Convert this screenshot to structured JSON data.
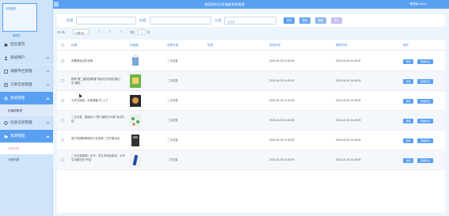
{
  "app": {
    "title": "校园资料分享储备系统管理",
    "user": "管理者 admin"
  },
  "sidebar": {
    "avatar_text": "清风校园",
    "avatar_label": "管理员",
    "items": [
      {
        "label": "后台首页",
        "icon": "home-icon",
        "has_sub": false
      },
      {
        "label": "系统用户",
        "icon": "user-icon",
        "has_sub": true
      },
      {
        "label": "海报专栏管理",
        "icon": "poster-icon",
        "has_sub": true
      },
      {
        "label": "订单信息管理",
        "icon": "order-icon",
        "has_sub": true
      },
      {
        "label": "系统管理",
        "icon": "gear-icon",
        "has_sub": true,
        "active": true
      },
      {
        "label": "社会信息管理",
        "icon": "info-icon",
        "has_sub": true
      },
      {
        "label": "资源管理",
        "icon": "folder-icon",
        "has_sub": true,
        "active": true
      }
    ],
    "sub_items": {
      "system": [
        "轮播图管理"
      ],
      "resource": [
        "资源列表",
        "分类列表"
      ]
    }
  },
  "search": {
    "label_1": "标题",
    "label_2": "标题",
    "label_3": "分类",
    "placeholder_3": "请选择",
    "btn_search": "查询",
    "btn_add": "新增",
    "btn_delete": "删除",
    "btn_export": "导出"
  },
  "pager": {
    "total_label": "共 6 条",
    "page_size": "10条/页",
    "prev": "<",
    "page": "1",
    "next": ">",
    "goto_label": "前往",
    "goto_value": "1",
    "page_unit": "页"
  },
  "table": {
    "headers": [
      "标题",
      "封面图",
      "资源分类",
      "标签",
      "发布时间",
      "更新时间",
      "操作"
    ],
    "rows": [
      {
        "title": "闲置物品出售说明",
        "category": "二手交易",
        "published": "2024-04-03 14:45:05",
        "updated": "2024-04-03 14:45:31",
        "thumb": "#7aa6d8"
      },
      {
        "title": "框架\"第二届校园新春书画文化作品征集公告\"通知",
        "category": "二手交易",
        "published": "2024-04-03 14:45:05",
        "updated": "2024-04-03 14:45:05",
        "thumb": "#6fb54a"
      },
      {
        "title": "大学生宿舍，你被哪套\"忘\"上了",
        "category": "二手交易",
        "published": "2024-04-03 14:45:05",
        "updated": "2024-04-03 14:45:05",
        "thumb": "#2a2a2a"
      },
      {
        "title": "二手交易，超级名人\"第十届知识大赛\"活动总结",
        "category": "二手交易",
        "published": "2024-04-03 14:45:05",
        "updated": "2024-04-03 14:45:05",
        "thumb": "#4ca86b"
      },
      {
        "title": "基于校园助教服务平台的第二次开展活动",
        "category": "二手交易",
        "published": "2024-04-03 14:45:05",
        "updated": "2024-04-03 14:45:05",
        "thumb": "#333333"
      },
      {
        "title": "二手交易周期二手书，学生学科免费领，大学生也能在校\"开始\"",
        "category": "二手交易",
        "published": "2024-04-03 14:45:05",
        "updated": "2024-04-03 14:45:05",
        "thumb": "#1d4ea8"
      }
    ],
    "action_edit": "详情",
    "action_view": "查看评论"
  },
  "colors": {
    "accent": "#5aa0f2",
    "sidebar": "#cfe3fb",
    "active_sub": "#f29aa0"
  }
}
